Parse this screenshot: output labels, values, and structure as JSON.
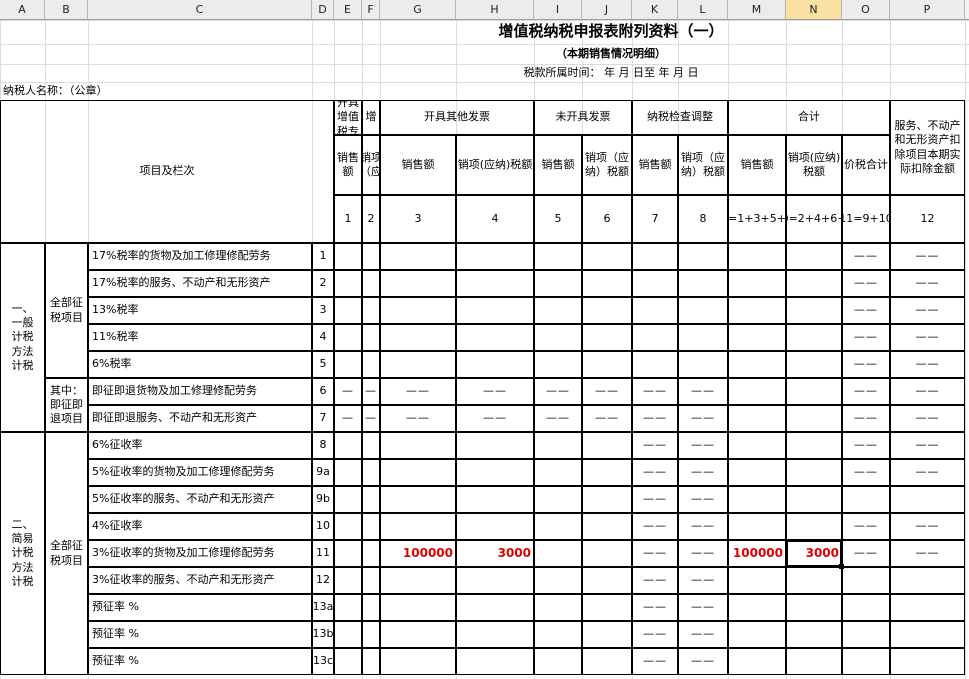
{
  "columns": [
    "A",
    "B",
    "C",
    "D",
    "E",
    "F",
    "G",
    "H",
    "I",
    "J",
    "K",
    "L",
    "M",
    "N",
    "O",
    "P"
  ],
  "selected_column": "N",
  "title": "增值税纳税申报表附列资料（一）",
  "subtitle": "（本期销售情况明细）",
  "period_label": "税款所属时间：  年  月  日至  年  月  日",
  "taxpayer_label": "纳税人名称：（公章）",
  "header": {
    "item_col": "项目及栏次",
    "g1": "开具增值税专用发票",
    "g1_short": "开具\n增值税专",
    "g2": "开具其他发票",
    "g3": "未开具发票",
    "g4": "纳税检查调整",
    "g5": "合计",
    "p": "服务、不动产和无形资产扣除项目本期实际扣除金额",
    "sales": "销售额",
    "tax": "销项(应纳)税额",
    "tax_short": "销项（应纳）税额",
    "total_tax": "销项(应纳)税额",
    "price_total": "价税合计",
    "e_sales": "销售额",
    "f_tax": "销项（应",
    "nums": [
      "1",
      "2",
      "3",
      "4",
      "5",
      "6",
      "7",
      "8",
      "9=1+3+5+7",
      "10=2+4+6+8",
      "11=9+10",
      "12"
    ]
  },
  "sections": {
    "general": "一、一般计税方法计税",
    "general_all": "全部征税项目",
    "general_refund": "其中：即征即退项目",
    "simple": "二、简易计税方法计税",
    "simple_all": "全部征税项目"
  },
  "rows": [
    {
      "label": "17%税率的货物及加工修理修配劳务",
      "no": "1"
    },
    {
      "label": "17%税率的服务、不动产和无形资产",
      "no": "2"
    },
    {
      "label": "13%税率",
      "no": "3"
    },
    {
      "label": "11%税率",
      "no": "4"
    },
    {
      "label": "6%税率",
      "no": "5"
    },
    {
      "label": "即征即退货物及加工修理修配劳务",
      "no": "6"
    },
    {
      "label": "即征即退服务、不动产和无形资产",
      "no": "7"
    },
    {
      "label": "6%征收率",
      "no": "8"
    },
    {
      "label": "5%征收率的货物及加工修理修配劳务",
      "no": "9a"
    },
    {
      "label": "5%征收率的服务、不动产和无形资产",
      "no": "9b"
    },
    {
      "label": "4%征收率",
      "no": "10"
    },
    {
      "label": "3%征收率的货物及加工修理修配劳务",
      "no": "11"
    },
    {
      "label": "3%征收率的服务、不动产和无形资产",
      "no": "12"
    },
    {
      "label": "预征率  %",
      "no": "13a"
    },
    {
      "label": "预征率  %",
      "no": "13b"
    },
    {
      "label": "预征率  %",
      "no": "13c"
    }
  ],
  "values": {
    "row11_g": "100000",
    "row11_h": "3000",
    "row11_m": "100000",
    "row11_n": "3000"
  },
  "dash": "——",
  "dash_small": "—"
}
